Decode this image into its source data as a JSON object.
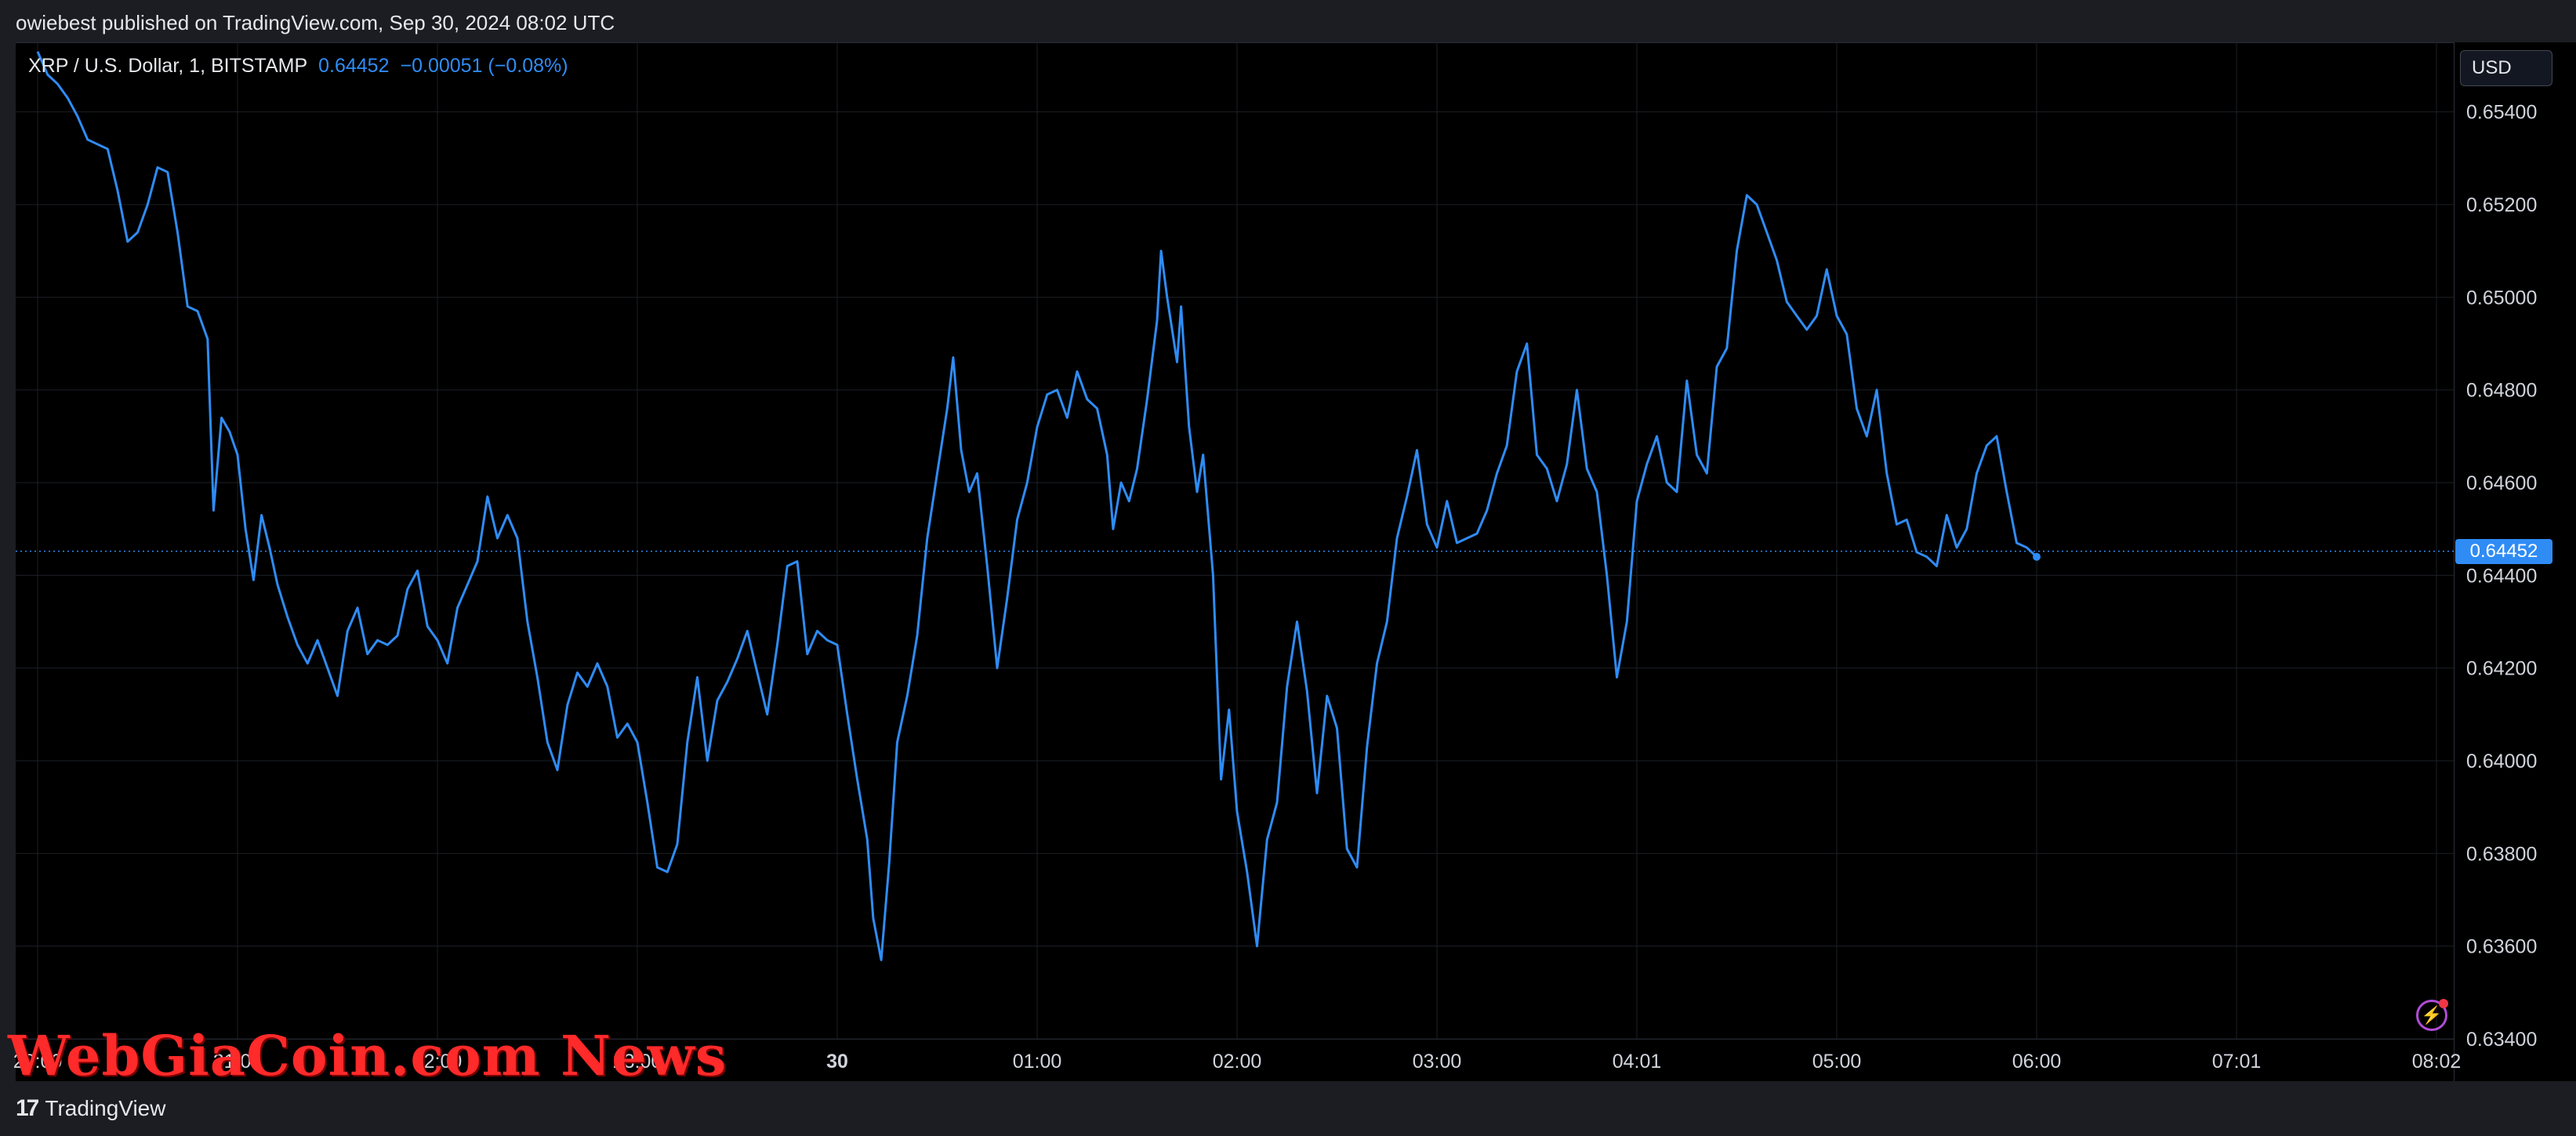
{
  "header": {
    "publish_line": "owiebest published on TradingView.com, Sep 30, 2024 08:02 UTC"
  },
  "legend": {
    "symbol": "XRP / U.S. Dollar, 1, BITSTAMP",
    "price": "0.64452",
    "change": "−0.00051 (−0.08%)"
  },
  "price_scale": {
    "currency": "USD",
    "last_price_tag": "0.64452"
  },
  "footer": {
    "brand": "TradingView",
    "logo_icon": "tradingview-logo-icon"
  },
  "watermark": "WebGiaCoin.com News",
  "colors": {
    "line": "#2f8cf5",
    "background": "#000000",
    "grid": "#1c1f26",
    "text": "#d1d4dc"
  },
  "chart_data": {
    "type": "line",
    "symbol": "XRP / U.S. Dollar",
    "interval": "1",
    "exchange": "BITSTAMP",
    "ylim": [
      0.634,
      0.6555
    ],
    "yticks": [
      0.654,
      0.652,
      0.65,
      0.648,
      0.646,
      0.644,
      0.642,
      0.64,
      0.638,
      0.636,
      0.634
    ],
    "ytick_labels": [
      "0.65400",
      "0.65200",
      "0.65000",
      "0.64800",
      "0.64600",
      "0.64400",
      "0.64200",
      "0.64000",
      "0.63800",
      "0.63600",
      "0.63400"
    ],
    "last_value": 0.64452,
    "xlabels": [
      {
        "label": "20:00",
        "t": 0.0
      },
      {
        "label": "21:00",
        "t": 1.0
      },
      {
        "label": "22:00",
        "t": 2.0
      },
      {
        "label": "23:00",
        "t": 3.0
      },
      {
        "label": "30",
        "t": 4.0,
        "bold": true
      },
      {
        "label": "01:00",
        "t": 5.0
      },
      {
        "label": "02:00",
        "t": 6.0
      },
      {
        "label": "03:00",
        "t": 7.0
      },
      {
        "label": "04:01",
        "t": 8.0
      },
      {
        "label": "05:00",
        "t": 9.0
      },
      {
        "label": "06:00",
        "t": 10.0
      },
      {
        "label": "07:01",
        "t": 11.0
      },
      {
        "label": "08:02",
        "t": 12.0
      }
    ],
    "grid": true,
    "series": [
      {
        "points": [
          [
            0.0,
            0.6553
          ],
          [
            0.05,
            0.6548
          ],
          [
            0.1,
            0.6546
          ],
          [
            0.15,
            0.6543
          ],
          [
            0.2,
            0.6539
          ],
          [
            0.25,
            0.6534
          ],
          [
            0.3,
            0.6533
          ],
          [
            0.35,
            0.6532
          ],
          [
            0.4,
            0.6523
          ],
          [
            0.45,
            0.6512
          ],
          [
            0.5,
            0.6514
          ],
          [
            0.55,
            0.652
          ],
          [
            0.6,
            0.6528
          ],
          [
            0.65,
            0.6527
          ],
          [
            0.7,
            0.6514
          ],
          [
            0.75,
            0.6498
          ],
          [
            0.8,
            0.6497
          ],
          [
            0.85,
            0.6491
          ],
          [
            0.88,
            0.6454
          ],
          [
            0.92,
            0.6474
          ],
          [
            0.96,
            0.6471
          ],
          [
            1.0,
            0.6466
          ],
          [
            1.04,
            0.645
          ],
          [
            1.08,
            0.6439
          ],
          [
            1.12,
            0.6453
          ],
          [
            1.16,
            0.6446
          ],
          [
            1.2,
            0.6438
          ],
          [
            1.25,
            0.6431
          ],
          [
            1.3,
            0.6425
          ],
          [
            1.35,
            0.6421
          ],
          [
            1.4,
            0.6426
          ],
          [
            1.45,
            0.642
          ],
          [
            1.5,
            0.6414
          ],
          [
            1.55,
            0.6428
          ],
          [
            1.6,
            0.6433
          ],
          [
            1.65,
            0.6423
          ],
          [
            1.7,
            0.6426
          ],
          [
            1.75,
            0.6425
          ],
          [
            1.8,
            0.6427
          ],
          [
            1.85,
            0.6437
          ],
          [
            1.9,
            0.6441
          ],
          [
            1.95,
            0.6429
          ],
          [
            2.0,
            0.6426
          ],
          [
            2.05,
            0.6421
          ],
          [
            2.1,
            0.6433
          ],
          [
            2.15,
            0.6438
          ],
          [
            2.2,
            0.6443
          ],
          [
            2.25,
            0.6457
          ],
          [
            2.3,
            0.6448
          ],
          [
            2.35,
            0.6453
          ],
          [
            2.4,
            0.6448
          ],
          [
            2.45,
            0.643
          ],
          [
            2.5,
            0.6418
          ],
          [
            2.55,
            0.6404
          ],
          [
            2.6,
            0.6398
          ],
          [
            2.65,
            0.6412
          ],
          [
            2.7,
            0.6419
          ],
          [
            2.75,
            0.6416
          ],
          [
            2.8,
            0.6421
          ],
          [
            2.85,
            0.6416
          ],
          [
            2.9,
            0.6405
          ],
          [
            2.95,
            0.6408
          ],
          [
            3.0,
            0.6404
          ],
          [
            3.05,
            0.6391
          ],
          [
            3.1,
            0.6377
          ],
          [
            3.15,
            0.6376
          ],
          [
            3.2,
            0.6382
          ],
          [
            3.25,
            0.6404
          ],
          [
            3.3,
            0.6418
          ],
          [
            3.35,
            0.64
          ],
          [
            3.4,
            0.6413
          ],
          [
            3.45,
            0.6417
          ],
          [
            3.5,
            0.6422
          ],
          [
            3.55,
            0.6428
          ],
          [
            3.6,
            0.6419
          ],
          [
            3.65,
            0.641
          ],
          [
            3.7,
            0.6425
          ],
          [
            3.75,
            0.6442
          ],
          [
            3.8,
            0.6443
          ],
          [
            3.85,
            0.6423
          ],
          [
            3.9,
            0.6428
          ],
          [
            3.95,
            0.6426
          ],
          [
            4.0,
            0.6425
          ],
          [
            4.05,
            0.641
          ],
          [
            4.1,
            0.6396
          ],
          [
            4.15,
            0.6383
          ],
          [
            4.18,
            0.6366
          ],
          [
            4.22,
            0.6357
          ],
          [
            4.26,
            0.6378
          ],
          [
            4.3,
            0.6404
          ],
          [
            4.35,
            0.6414
          ],
          [
            4.4,
            0.6427
          ],
          [
            4.45,
            0.6448
          ],
          [
            4.5,
            0.6462
          ],
          [
            4.55,
            0.6476
          ],
          [
            4.58,
            0.6487
          ],
          [
            4.62,
            0.6467
          ],
          [
            4.66,
            0.6458
          ],
          [
            4.7,
            0.6462
          ],
          [
            4.75,
            0.6442
          ],
          [
            4.8,
            0.642
          ],
          [
            4.85,
            0.6435
          ],
          [
            4.9,
            0.6452
          ],
          [
            4.95,
            0.646
          ],
          [
            5.0,
            0.6472
          ],
          [
            5.05,
            0.6479
          ],
          [
            5.1,
            0.648
          ],
          [
            5.15,
            0.6474
          ],
          [
            5.2,
            0.6484
          ],
          [
            5.25,
            0.6478
          ],
          [
            5.3,
            0.6476
          ],
          [
            5.35,
            0.6466
          ],
          [
            5.38,
            0.645
          ],
          [
            5.42,
            0.646
          ],
          [
            5.46,
            0.6456
          ],
          [
            5.5,
            0.6463
          ],
          [
            5.55,
            0.6478
          ],
          [
            5.6,
            0.6495
          ],
          [
            5.62,
            0.651
          ],
          [
            5.65,
            0.65
          ],
          [
            5.7,
            0.6486
          ],
          [
            5.72,
            0.6498
          ],
          [
            5.76,
            0.6472
          ],
          [
            5.8,
            0.6458
          ],
          [
            5.83,
            0.6466
          ],
          [
            5.88,
            0.644
          ],
          [
            5.92,
            0.6396
          ],
          [
            5.96,
            0.6411
          ],
          [
            6.0,
            0.6389
          ],
          [
            6.05,
            0.6376
          ],
          [
            6.1,
            0.636
          ],
          [
            6.15,
            0.6383
          ],
          [
            6.2,
            0.6391
          ],
          [
            6.25,
            0.6416
          ],
          [
            6.3,
            0.643
          ],
          [
            6.35,
            0.6415
          ],
          [
            6.4,
            0.6393
          ],
          [
            6.45,
            0.6414
          ],
          [
            6.5,
            0.6407
          ],
          [
            6.55,
            0.6381
          ],
          [
            6.6,
            0.6377
          ],
          [
            6.65,
            0.6403
          ],
          [
            6.7,
            0.6421
          ],
          [
            6.75,
            0.643
          ],
          [
            6.8,
            0.6448
          ],
          [
            6.85,
            0.6457
          ],
          [
            6.9,
            0.6467
          ],
          [
            6.95,
            0.6451
          ],
          [
            7.0,
            0.6446
          ],
          [
            7.05,
            0.6456
          ],
          [
            7.1,
            0.6447
          ],
          [
            7.15,
            0.6448
          ],
          [
            7.2,
            0.6449
          ],
          [
            7.25,
            0.6454
          ],
          [
            7.3,
            0.6462
          ],
          [
            7.35,
            0.6468
          ],
          [
            7.4,
            0.6484
          ],
          [
            7.45,
            0.649
          ],
          [
            7.5,
            0.6466
          ],
          [
            7.55,
            0.6463
          ],
          [
            7.6,
            0.6456
          ],
          [
            7.65,
            0.6464
          ],
          [
            7.7,
            0.648
          ],
          [
            7.75,
            0.6463
          ],
          [
            7.8,
            0.6458
          ],
          [
            7.85,
            0.644
          ],
          [
            7.9,
            0.6418
          ],
          [
            7.95,
            0.643
          ],
          [
            8.0,
            0.6456
          ],
          [
            8.05,
            0.6464
          ],
          [
            8.1,
            0.647
          ],
          [
            8.15,
            0.646
          ],
          [
            8.2,
            0.6458
          ],
          [
            8.25,
            0.6482
          ],
          [
            8.3,
            0.6466
          ],
          [
            8.35,
            0.6462
          ],
          [
            8.4,
            0.6485
          ],
          [
            8.45,
            0.6489
          ],
          [
            8.5,
            0.651
          ],
          [
            8.55,
            0.6522
          ],
          [
            8.6,
            0.652
          ],
          [
            8.65,
            0.6514
          ],
          [
            8.7,
            0.6508
          ],
          [
            8.75,
            0.6499
          ],
          [
            8.8,
            0.6496
          ],
          [
            8.85,
            0.6493
          ],
          [
            8.9,
            0.6496
          ],
          [
            8.95,
            0.6506
          ],
          [
            9.0,
            0.6496
          ],
          [
            9.05,
            0.6492
          ],
          [
            9.1,
            0.6476
          ],
          [
            9.15,
            0.647
          ],
          [
            9.2,
            0.648
          ],
          [
            9.25,
            0.6462
          ],
          [
            9.3,
            0.6451
          ],
          [
            9.35,
            0.6452
          ],
          [
            9.4,
            0.6445
          ],
          [
            9.45,
            0.6444
          ],
          [
            9.5,
            0.6442
          ],
          [
            9.55,
            0.6453
          ],
          [
            9.6,
            0.6446
          ],
          [
            9.65,
            0.645
          ],
          [
            9.7,
            0.6462
          ],
          [
            9.75,
            0.6468
          ],
          [
            9.8,
            0.647
          ],
          [
            9.85,
            0.6458
          ],
          [
            9.9,
            0.6447
          ],
          [
            9.95,
            0.6446
          ],
          [
            10.0,
            0.6444
          ]
        ]
      }
    ]
  }
}
